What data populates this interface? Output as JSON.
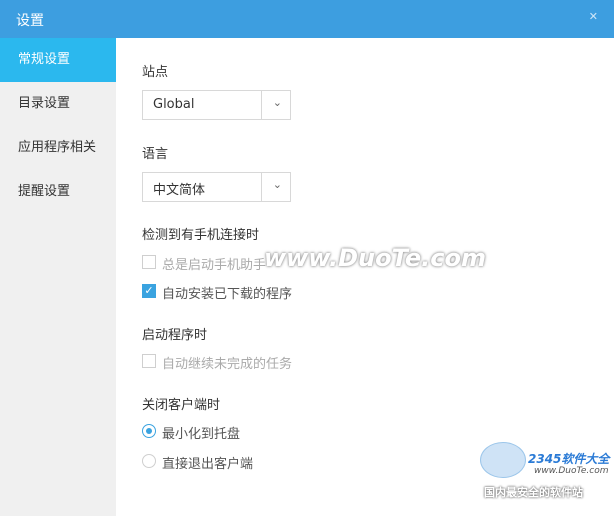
{
  "window": {
    "title": "设置",
    "close_glyph": "✕",
    "accent": "#3d9ee0"
  },
  "sidebar": {
    "items": [
      {
        "label": "常规设置",
        "active": true
      },
      {
        "label": "目录设置",
        "active": false
      },
      {
        "label": "应用程序相关",
        "active": false
      },
      {
        "label": "提醒设置",
        "active": false
      }
    ]
  },
  "main": {
    "site": {
      "label": "站点",
      "value": "Global"
    },
    "language": {
      "label": "语言",
      "value": "中文简体"
    },
    "phone": {
      "label": "检测到有手机连接时",
      "always_open_helper": {
        "text": "总是启动手机助手",
        "checked": false,
        "disabled": true
      },
      "auto_install": {
        "text": "自动安装已下载的程序",
        "checked": true,
        "disabled": false
      }
    },
    "startup": {
      "label": "启动程序时",
      "auto_resume": {
        "text": "自动继续未完成的任务",
        "checked": false,
        "disabled": true
      }
    },
    "close": {
      "label": "关闭客户端时",
      "minimize": {
        "text": "最小化到托盘",
        "selected": true
      },
      "exit": {
        "text": "直接退出客户端",
        "selected": false
      }
    }
  },
  "watermark": {
    "text": "www.DuoTe.com"
  },
  "logo": {
    "brand": "2345软件大全",
    "site": "www.DuoTe.com",
    "slogan": "国内最安全的软件站"
  },
  "icons": {
    "dropdown": "chevron-down-icon",
    "check": "checkmark-icon",
    "close": "close-icon"
  }
}
